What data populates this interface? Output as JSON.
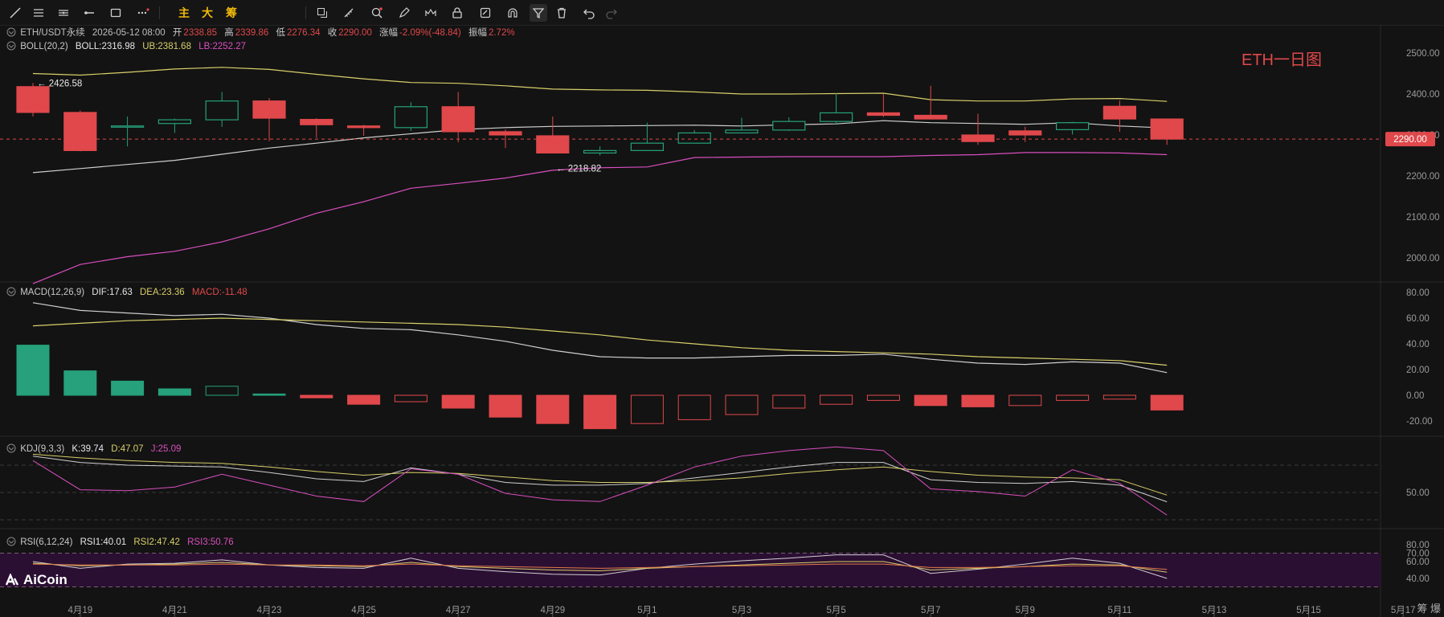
{
  "toolbar": {
    "cn_buttons": [
      "主",
      "大",
      "筹"
    ],
    "icons": [
      "trend-line-icon",
      "horizontal-lines-icon",
      "parallel-channel-icon",
      "horizontal-ray-icon",
      "rectangle-icon",
      "dots-menu-icon",
      "copy-icon",
      "ruler-icon",
      "zoom-search-icon",
      "brush-icon",
      "pattern-icon",
      "lock-icon",
      "edit-note-icon",
      "magnet-icon",
      "filter-icon",
      "trash-icon",
      "undo-icon",
      "redo-icon"
    ]
  },
  "price_panel": {
    "symbol": "ETH/USDT永续",
    "datetime": "2026-05-12 08:00",
    "open_label": "开",
    "open": "2338.85",
    "high_label": "高",
    "high": "2339.86",
    "low_label": "低",
    "low": "2276.34",
    "close_label": "收",
    "close": "2290.00",
    "change_label": "涨幅",
    "change": "-2.09%(-48.84)",
    "amplitude_label": "振幅",
    "amplitude": "2.72%",
    "boll_name": "BOLL(20,2)",
    "boll_mid": "BOLL:2316.98",
    "boll_ub": "UB:2381.68",
    "boll_lb": "LB:2252.27",
    "annotation": "ETH一日图",
    "max_label": "← 2426.58",
    "min_label": "← 2218.82",
    "last_price_tag": "2290.00",
    "axis_ticks": [
      "2500.00",
      "2400.00",
      "2300.00",
      "2200.00",
      "2100.00",
      "2000.00"
    ]
  },
  "macd_panel": {
    "name": "MACD(12,26,9)",
    "dif": "DIF:17.63",
    "dea": "DEA:23.36",
    "macd": "MACD:-11.48",
    "axis_ticks": [
      "80.00",
      "60.00",
      "40.00",
      "20.00",
      "0.00",
      "-20.00"
    ]
  },
  "kdj_panel": {
    "name": "KDJ(9,3,3)",
    "k": "K:39.74",
    "d": "D:47.07",
    "j": "J:25.09",
    "axis_ticks": [
      "50.00"
    ]
  },
  "rsi_panel": {
    "name": "RSI(6,12,24)",
    "rsi1": "RSI1:40.01",
    "rsi2": "RSI2:47.42",
    "rsi3": "RSI3:50.76",
    "axis_ticks": [
      "80.00",
      "70.00",
      "60.00",
      "40.00"
    ]
  },
  "x_axis_labels": [
    "4月19",
    "4月21",
    "4月23",
    "4月25",
    "4月27",
    "4月29",
    "5月1",
    "5月3",
    "5月5",
    "5月7",
    "5月9",
    "5月11",
    "5月13",
    "5月15",
    "5月17"
  ],
  "logo_text": "AiCoin",
  "corner_text": "筹 爆",
  "colors": {
    "up": "#26a17b",
    "down": "#e0484b",
    "boll_upper": "#d8cf6a",
    "boll_mid": "#cfcfcf",
    "boll_lower": "#d94fbf",
    "rsi_bg": "#2b0f33",
    "last_price": "#e0484b"
  },
  "chart_data": [
    {
      "type": "candlestick",
      "title": "ETH/USDT永续",
      "dates": [
        "4月18",
        "4月19",
        "4月20",
        "4月21",
        "4月22",
        "4月23",
        "4月24",
        "4月25",
        "4月26",
        "4月27",
        "4月28",
        "4月29",
        "4月30",
        "5月1",
        "5月2",
        "5月3",
        "5月4",
        "5月5",
        "5月6",
        "5月7",
        "5月8",
        "5月9",
        "5月10",
        "5月11",
        "5月12"
      ],
      "open": [
        2418,
        2355,
        2322,
        2328,
        2337,
        2383,
        2338,
        2322,
        2318,
        2369,
        2308,
        2298,
        2256,
        2262,
        2280,
        2305,
        2312,
        2333,
        2354,
        2348,
        2300,
        2310,
        2313,
        2370,
        2339
      ],
      "high": [
        2427,
        2360,
        2345,
        2340,
        2405,
        2390,
        2341,
        2325,
        2380,
        2405,
        2314,
        2345,
        2272,
        2330,
        2312,
        2342,
        2343,
        2402,
        2400,
        2420,
        2352,
        2320,
        2332,
        2384,
        2340
      ],
      "low": [
        2345,
        2260,
        2272,
        2305,
        2320,
        2285,
        2293,
        2298,
        2310,
        2282,
        2268,
        2255,
        2250,
        2262,
        2280,
        2305,
        2310,
        2325,
        2344,
        2338,
        2276,
        2283,
        2301,
        2308,
        2276
      ],
      "close": [
        2355,
        2262,
        2322,
        2337,
        2383,
        2341,
        2325,
        2318,
        2369,
        2308,
        2300,
        2256,
        2262,
        2280,
        2305,
        2312,
        2333,
        2354,
        2348,
        2339,
        2284,
        2300,
        2330,
        2339,
        2290
      ],
      "boll_upper": [
        2450,
        2446,
        2453,
        2461,
        2465,
        2460,
        2448,
        2437,
        2428,
        2426,
        2420,
        2412,
        2410,
        2409,
        2405,
        2400,
        2400,
        2401,
        2402,
        2386,
        2383,
        2383,
        2388,
        2389,
        2382
      ],
      "boll_mid": [
        2208,
        2218,
        2228,
        2238,
        2253,
        2268,
        2280,
        2293,
        2303,
        2313,
        2318,
        2321,
        2322,
        2323,
        2324,
        2322,
        2325,
        2327,
        2335,
        2330,
        2328,
        2326,
        2330,
        2322,
        2317
      ],
      "boll_lower": [
        1937,
        1984,
        2003,
        2016,
        2039,
        2071,
        2109,
        2137,
        2170,
        2182,
        2195,
        2214,
        2220,
        2222,
        2245,
        2246,
        2247,
        2247,
        2247,
        2250,
        2252,
        2257,
        2257,
        2256,
        2252
      ],
      "ylim": [
        1950,
        2530
      ]
    },
    {
      "type": "bar",
      "title": "MACD(12,26,9)",
      "values": [
        39,
        19,
        11,
        5,
        7,
        1,
        -2,
        -7,
        -5,
        -10,
        -17,
        -22,
        -26,
        -22,
        -19,
        -15,
        -10,
        -7,
        -4,
        -8,
        -9,
        -8,
        -4,
        -3,
        -11.48
      ],
      "dif": [
        72,
        66,
        64,
        62,
        63,
        60,
        55,
        52,
        51,
        47,
        42,
        35,
        30,
        29,
        29,
        30,
        31,
        31,
        32,
        28,
        25,
        24,
        26,
        25,
        17.63
      ],
      "dea": [
        54,
        56,
        58,
        59,
        60,
        59,
        58,
        57,
        56,
        55,
        53,
        50,
        47,
        43,
        40,
        37,
        35,
        34,
        33,
        32,
        30,
        29,
        28,
        27,
        23.36
      ],
      "ylim": [
        -28,
        85
      ]
    },
    {
      "type": "line",
      "title": "KDJ(9,3,3)",
      "k": [
        90,
        83,
        80,
        79,
        78,
        72,
        65,
        62,
        77,
        70,
        61,
        58,
        58,
        60,
        66,
        72,
        78,
        83,
        83,
        64,
        61,
        60,
        62,
        58,
        39.74
      ],
      "d": [
        92,
        88,
        85,
        83,
        82,
        78,
        73,
        69,
        72,
        71,
        67,
        63,
        61,
        61,
        63,
        66,
        71,
        75,
        78,
        73,
        69,
        67,
        66,
        64,
        47.07
      ],
      "j": [
        85,
        53,
        52,
        56,
        70,
        58,
        46,
        40,
        76,
        70,
        49,
        42,
        40,
        58,
        78,
        90,
        96,
        100,
        96,
        54,
        51,
        46,
        75,
        60,
        25.09
      ],
      "ylim": [
        0,
        100
      ]
    },
    {
      "type": "line",
      "title": "RSI(6,12,24)",
      "rsi1": [
        60,
        52,
        57,
        58,
        62,
        56,
        53,
        52,
        64,
        52,
        48,
        45,
        44,
        52,
        57,
        61,
        64,
        68,
        68,
        46,
        51,
        57,
        64,
        58,
        40.01
      ],
      "rsi2": [
        58,
        55,
        56,
        57,
        59,
        56,
        55,
        54,
        59,
        54,
        52,
        50,
        49,
        52,
        54,
        56,
        58,
        60,
        60,
        50,
        52,
        54,
        57,
        56,
        47.42
      ],
      "rsi3": [
        57,
        56,
        56,
        56,
        57,
        56,
        56,
        55,
        57,
        55,
        54,
        53,
        52,
        53,
        54,
        55,
        56,
        57,
        57,
        53,
        53,
        54,
        55,
        55,
        50.76
      ],
      "ylim": [
        30,
        85
      ]
    }
  ]
}
